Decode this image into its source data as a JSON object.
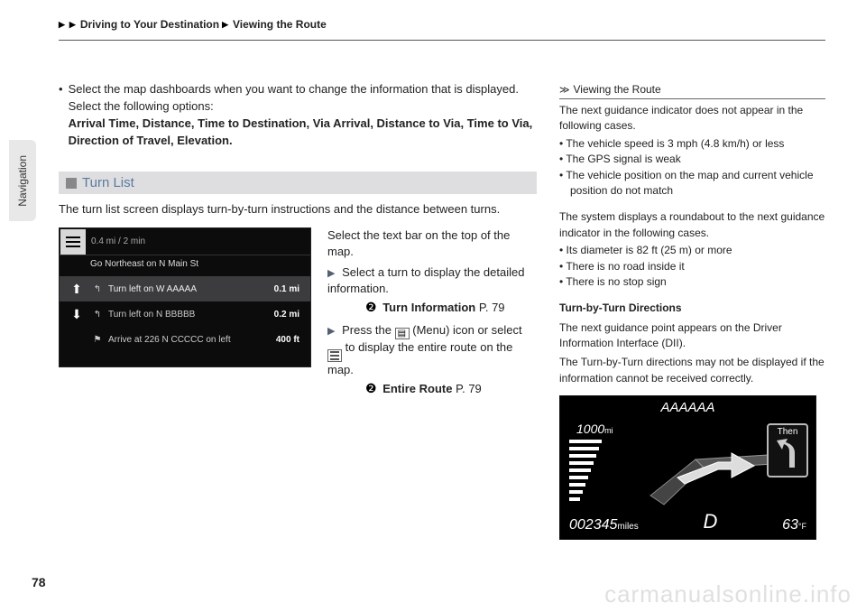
{
  "breadcrumb": {
    "a": "Driving to Your Destination",
    "b": "Viewing the Route"
  },
  "sidetab": "Navigation",
  "main": {
    "bullet1a": "Select the map dashboards when you want to change the information that is displayed. Select the following options:",
    "bullet1b": "Arrival Time, Distance, Time to Destination, Via Arrival, Distance to Via, Time to Via, Direction of Travel, Elevation.",
    "turnlist_h": "Turn List",
    "turnlist_p": "The turn list screen displays turn-by-turn instructions and the distance between turns.",
    "nav": {
      "top": "0.4 mi / 2 min",
      "go": "Go Northeast on N Main St",
      "r1t": "Turn left on W AAAAA",
      "r1d": "0.1 mi",
      "r2t": "Turn left on N BBBBB",
      "r2d": "0.2 mi",
      "r3t": "Arrive at 226 N CCCCC   on left",
      "r3d": "400 ft"
    },
    "right": {
      "p1": "Select the text bar on the top of the map.",
      "b1": "Select a turn to display the detailed information.",
      "x1": "Turn Information",
      "x1p": "P. 79",
      "b2a": "Press the ",
      "b2b": " (Menu) icon or select ",
      "b2c": " to display the entire route on the map.",
      "x2": "Entire Route",
      "x2p": "P. 79"
    }
  },
  "side": {
    "h": "Viewing the Route",
    "p1": "The next guidance indicator does not appear in the following cases.",
    "l1a": "The vehicle speed is 3 mph (4.8 km/h) or less",
    "l1b": "The GPS signal is weak",
    "l1c": "The vehicle position on the map and current vehicle position do not match",
    "p2": "The system displays a roundabout to the next guidance indicator in the following cases.",
    "l2a": "Its diameter is 82 ft (25 m) or more",
    "l2b": "There is no road inside it",
    "l2c": "There is no stop sign",
    "h2": "Turn-by-Turn Directions",
    "p3": "The next guidance point appears on the Driver Information Interface (DII).",
    "p4": "The Turn-by-Turn directions may not be displayed if the information cannot be received correctly.",
    "dii": {
      "title": "AAAAAA",
      "dist": "1000",
      "distu": "mi",
      "then": "Then",
      "odo": "002345",
      "odou": "miles",
      "gear": "D",
      "temp": "63",
      "tempu": "°F"
    }
  },
  "pagenum": "78",
  "watermark": "carmanualsonline.info"
}
